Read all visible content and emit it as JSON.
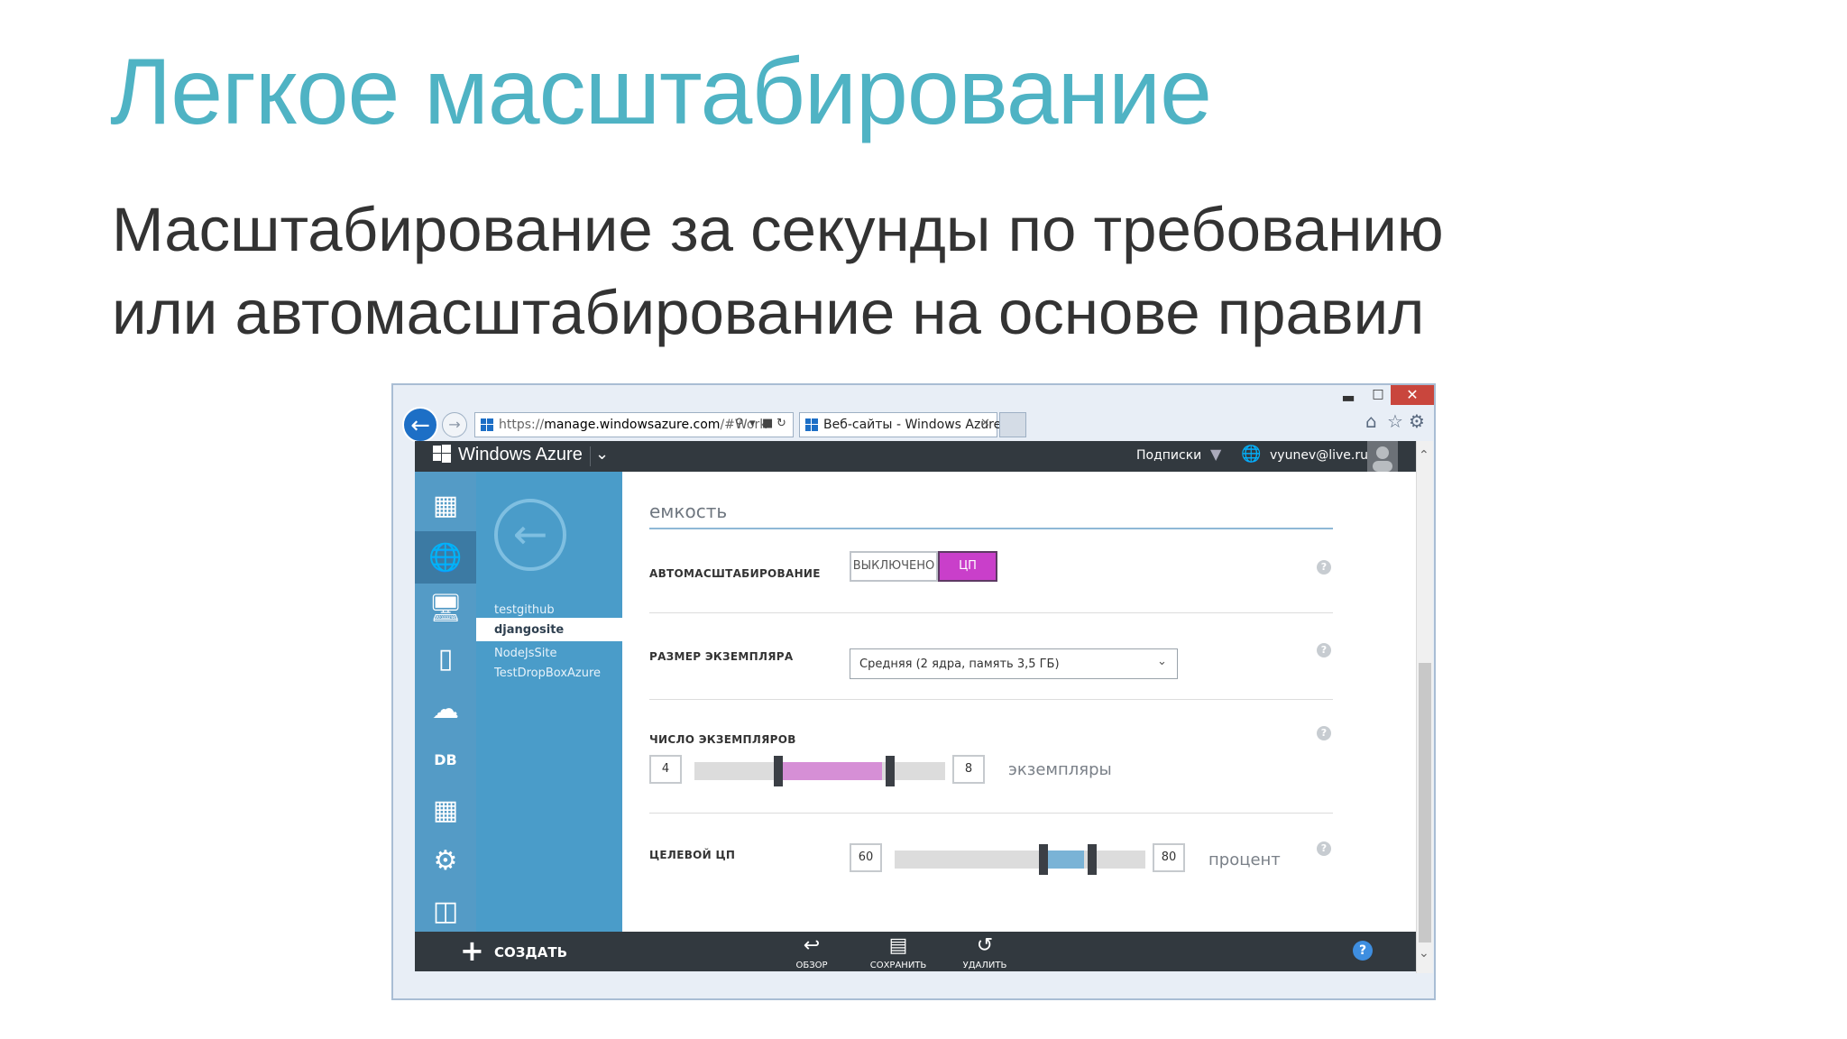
{
  "slide": {
    "title": "Легкое масштабирование",
    "subtitle_line1": "Масштабирование за секунды по требованию",
    "subtitle_line2": "или автомасштабирование на основе правил"
  },
  "browser": {
    "url_prefix": "https://",
    "url_host": "manage.windowsazure.com",
    "url_rest": "/#Work",
    "tab_title": "Веб-сайты - Windows Azure"
  },
  "portal": {
    "brand": "Windows Azure",
    "subscriptions_label": "Подписки",
    "user_email": "vyunev@live.ru",
    "sites": [
      "testgithub",
      "djangosite",
      "NodeJsSite",
      "TestDropBoxAzure"
    ],
    "selected_site": "djangosite",
    "section_title": "емкость",
    "autoscale": {
      "label": "АВТОМАСШТАБИРОВАНИЕ",
      "off_label": "ВЫКЛЮЧЕНО",
      "cpu_label": "ЦП",
      "selected": "ЦП"
    },
    "instance_size": {
      "label": "РАЗМЕР ЭКЗЕМПЛЯРА",
      "value": "Средняя (2 ядра, память 3,5 ГБ)"
    },
    "instance_count": {
      "label": "ЧИСЛО ЭКЗЕМПЛЯРОВ",
      "min": "4",
      "max": "8",
      "unit": "экземпляры"
    },
    "target_cpu": {
      "label": "ЦЕЛЕВОЙ ЦП",
      "min": "60",
      "max": "80",
      "unit": "процент"
    },
    "commands": {
      "create": "СОЗДАТЬ",
      "browse": "ОБЗОР",
      "save": "СОХРАНИТЬ",
      "delete": "УДАЛИТЬ"
    },
    "colors": {
      "accent_title": "#4fb3c4",
      "sidebar": "#549bc6",
      "toggle_on": "#c93fca",
      "instance_range": "#d68fd6",
      "cpu_range": "#7ab3d6"
    }
  }
}
